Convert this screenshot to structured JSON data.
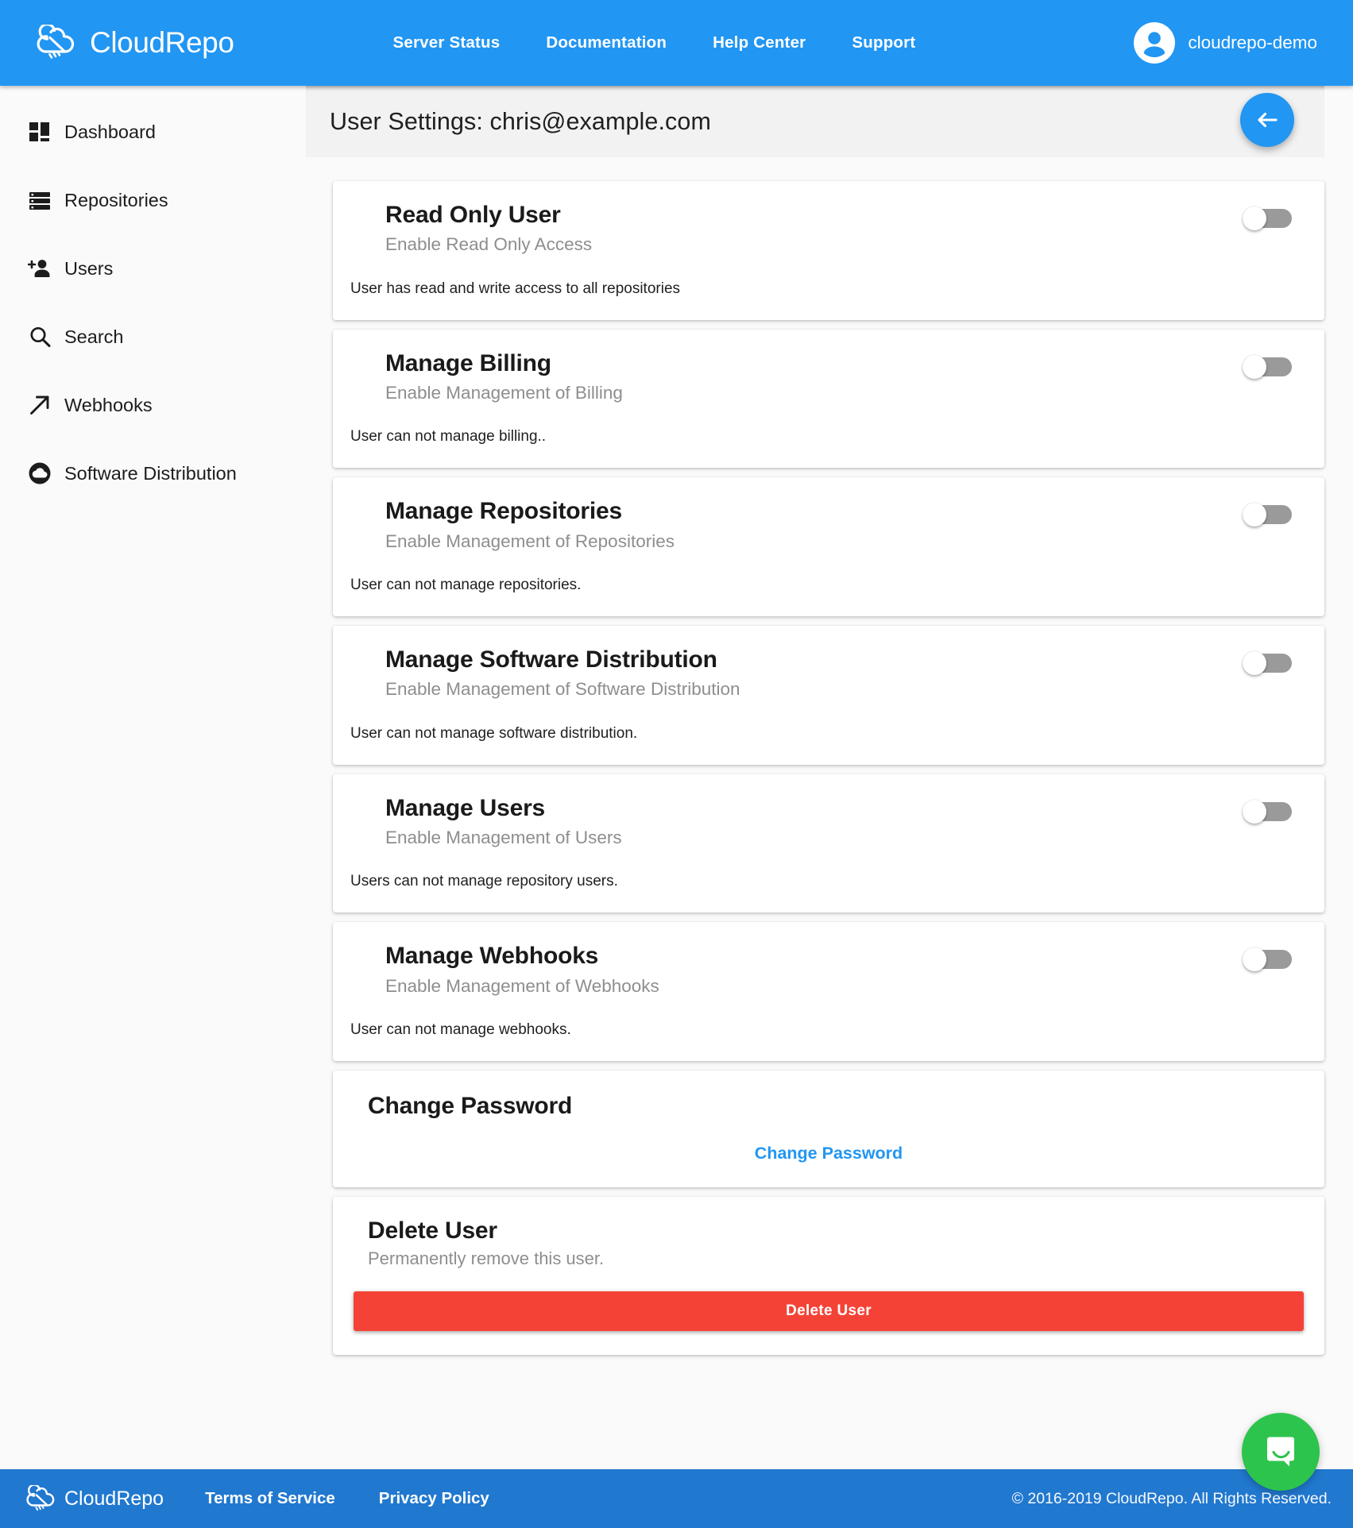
{
  "topnav": {
    "brand": "CloudRepo",
    "links": [
      {
        "label": "Server Status"
      },
      {
        "label": "Documentation"
      },
      {
        "label": "Help Center"
      },
      {
        "label": "Support"
      }
    ],
    "user": "cloudrepo-demo"
  },
  "sidebar": {
    "items": [
      {
        "label": "Dashboard",
        "icon": "dashboard-icon"
      },
      {
        "label": "Repositories",
        "icon": "repositories-icon"
      },
      {
        "label": "Users",
        "icon": "add-user-icon"
      },
      {
        "label": "Search",
        "icon": "search-icon"
      },
      {
        "label": "Webhooks",
        "icon": "arrow-up-right-icon"
      },
      {
        "label": "Software Distribution",
        "icon": "cloud-icon"
      }
    ]
  },
  "page": {
    "title": "User Settings: chris@example.com",
    "back_button_icon": "arrow-left-icon"
  },
  "permissions": [
    {
      "title": "Read Only User",
      "subtitle": "Enable Read Only Access",
      "description": "User has read and write access to all repositories",
      "enabled": false
    },
    {
      "title": "Manage Billing",
      "subtitle": "Enable Management of Billing",
      "description": "User can not manage billing..",
      "enabled": false
    },
    {
      "title": "Manage Repositories",
      "subtitle": "Enable Management of Repositories",
      "description": "User can not manage repositories.",
      "enabled": false
    },
    {
      "title": "Manage Software Distribution",
      "subtitle": "Enable Management of Software Distribution",
      "description": "User can not manage software distribution.",
      "enabled": false
    },
    {
      "title": "Manage Users",
      "subtitle": "Enable Management of Users",
      "description": "Users can not manage repository users.",
      "enabled": false
    },
    {
      "title": "Manage Webhooks",
      "subtitle": "Enable Management of Webhooks",
      "description": "User can not manage webhooks.",
      "enabled": false
    }
  ],
  "change_password": {
    "title": "Change Password",
    "link_label": "Change Password"
  },
  "delete_user": {
    "title": "Delete User",
    "subtitle": "Permanently remove this user.",
    "button_label": "Delete User"
  },
  "footer": {
    "brand": "CloudRepo",
    "links": [
      {
        "label": "Terms of Service"
      },
      {
        "label": "Privacy Policy"
      }
    ],
    "copyright": "© 2016-2019 CloudRepo. All Rights Reserved."
  },
  "chat": {
    "icon": "chat-bubble-icon"
  },
  "colors": {
    "brand_blue": "#2196f3",
    "footer_blue": "#2178cf",
    "danger_red": "#f44336",
    "chat_green": "#2dc44d",
    "toggle_off_track": "#9a9a9a",
    "muted_text": "#8e8e8e"
  }
}
